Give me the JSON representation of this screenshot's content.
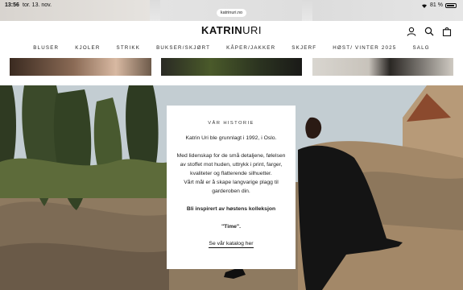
{
  "status_bar": {
    "time": "13:56",
    "date": "tor. 13. nov.",
    "url": "katrinuri.no",
    "battery": "81 %"
  },
  "header": {
    "logo_bold": "KATRIN",
    "logo_light": "URI",
    "icons": [
      "user-icon",
      "search-icon",
      "bag-icon"
    ]
  },
  "nav": {
    "items": [
      "BLUSER",
      "KJOLER",
      "STRIKK",
      "BUKSER/SKJØRT",
      "KÅPER/JAKKER",
      "SKJERF",
      "HØST/ VINTER 2025",
      "SALG"
    ]
  },
  "story": {
    "eyebrow": "VÅR HISTORIE",
    "line1": "Katrin Uri ble grunnlagt i 1992, i Oslo.",
    "para": [
      "Med lidenskap for de små detaljene, følelsen",
      "av stoffet mot huden, uttrykk i print, farger,",
      "kvaliteter og flatterende silhuetter.",
      "Vårt mål er å skape langvarige plagg til",
      "garderoben din."
    ],
    "bold": "Bli inspirert av høstens kolleksjon",
    "quote": "\"Time\".",
    "link": "Se vår katalog her"
  },
  "colors": {
    "accent": "#111111",
    "background": "#ffffff",
    "status_bar": "#e2e2e2"
  }
}
